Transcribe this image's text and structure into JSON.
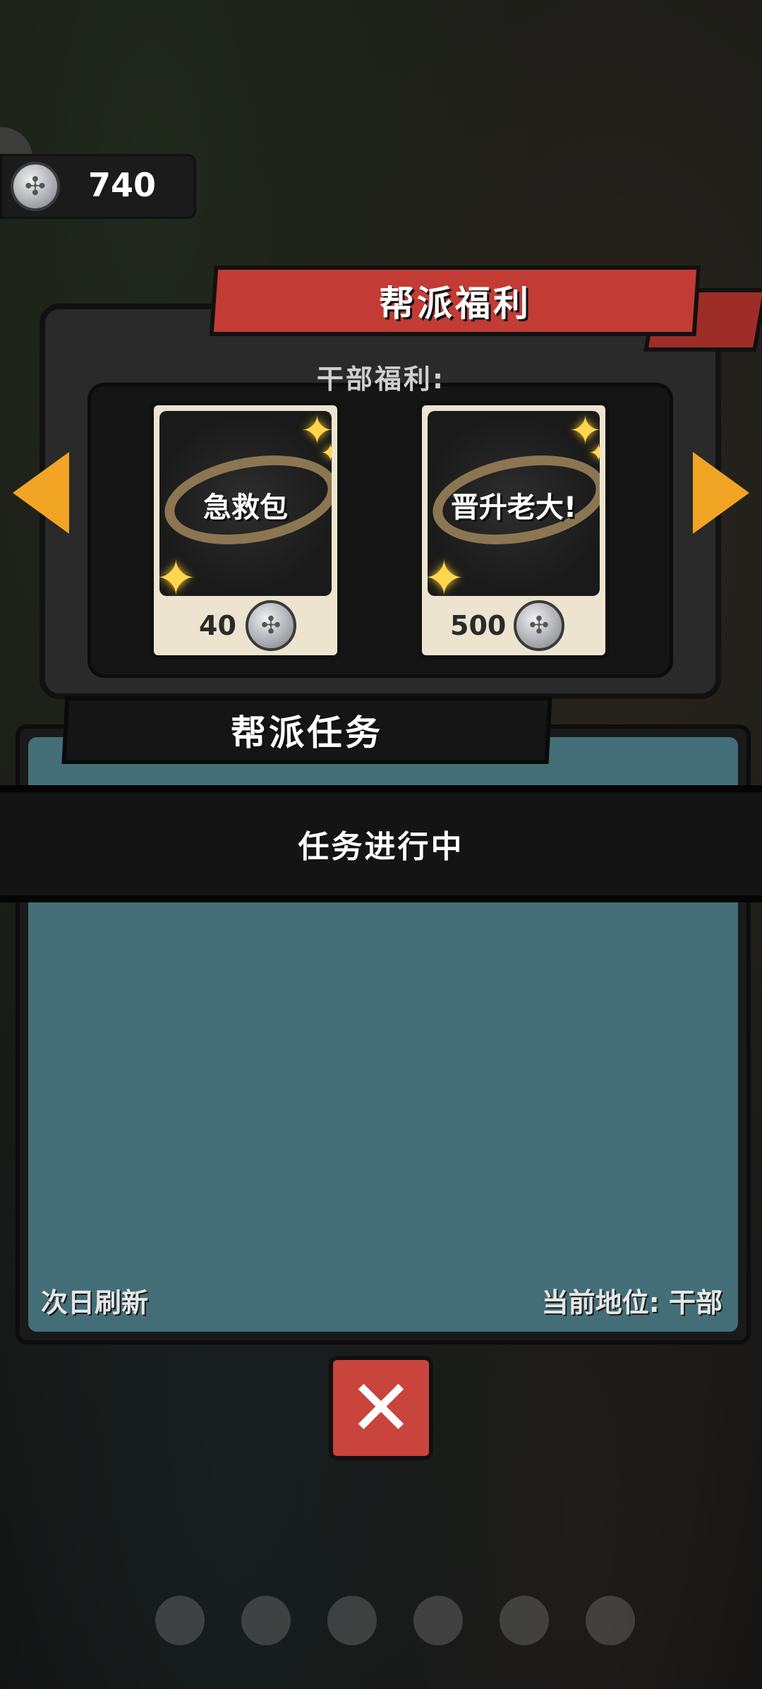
{
  "currency": {
    "amount": "740",
    "icon": "silver-coin-icon"
  },
  "welfare": {
    "title": "帮派福利",
    "subtitle": "干部福利:",
    "cards": [
      {
        "label": "急救包",
        "cost": "40"
      },
      {
        "label": "晋升老大!",
        "cost": "500"
      }
    ]
  },
  "task": {
    "title": "帮派任务",
    "status": "任务进行中",
    "refresh": "次日刷新",
    "rank": "当前地位: 干部"
  },
  "colors": {
    "accent_red": "#c23b34",
    "arrow": "#f2a424",
    "task_bg": "#436e78"
  }
}
